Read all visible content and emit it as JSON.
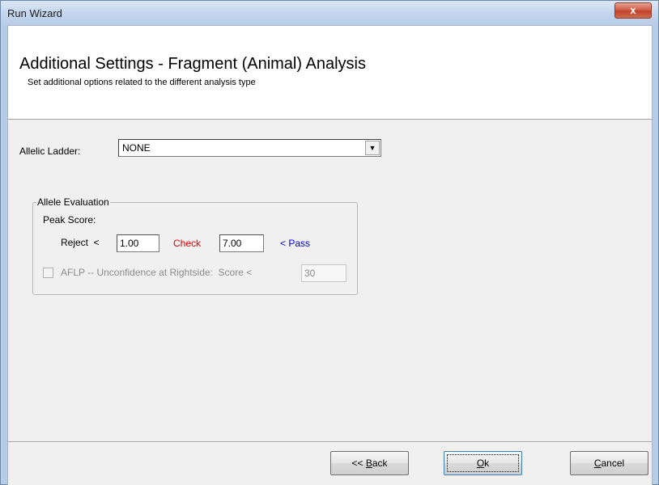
{
  "window": {
    "title": "Run Wizard",
    "close_glyph": "x"
  },
  "header": {
    "title": "Additional Settings - Fragment (Animal) Analysis",
    "subtitle": "Set additional options related to the different analysis type"
  },
  "ladder": {
    "label": "Allelic Ladder:",
    "value": "NONE"
  },
  "allele_evaluation": {
    "group_label": "Allele Evaluation",
    "peak_score_label": "Peak Score:",
    "reject_label": "Reject  <",
    "reject_value": "1.00",
    "check_label": "Check",
    "check_value": "7.00",
    "pass_label": "< Pass",
    "aflp_label": "AFLP -- Unconfidence at Rightside:  Score <",
    "aflp_checked": false,
    "aflp_value": "30"
  },
  "buttons": {
    "back_prefix": "<< ",
    "back_key": "B",
    "back_rest": "ack",
    "ok_key": "O",
    "ok_rest": "k",
    "cancel_key": "C",
    "cancel_rest": "ancel"
  }
}
